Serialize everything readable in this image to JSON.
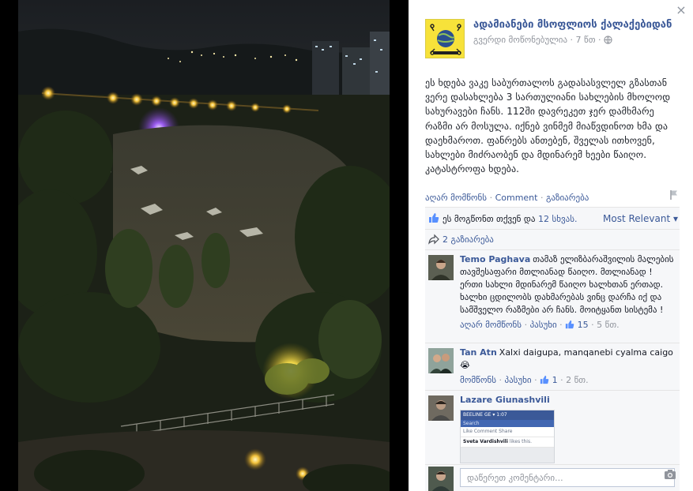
{
  "panel": {
    "close_label": "×",
    "page_name": "ადამიანები მსოფლიოს ქალაქებიდან",
    "page_meta": "გვერდი მოწონებულია · 7 წთ ·",
    "post_text": "ეს ხდება ვაკე საბურთალოს გადასასვლელ გზასთან ვერე დასახლება 3 სართულიანი სახლების მხოლოდ სახურავები ჩანს. 112ში დავრეკეთ ჯერ დამხმარე რაზმი არ მოსულა. იქნებ ვინმემ მიაწვდინოთ ხმა და დაეხმაროთ. ფანრებს ანთებენ, შველას ითხოვენ, სახლები მიძრაობენ და მდინარემ ხეები წაიღო. კატასტროფა ხდება.",
    "actions": {
      "unlike": "აღარ მომწონს",
      "comment": "Comment",
      "share": "გაზიარება",
      "sep": "·"
    },
    "likes": {
      "text_before": "ეს მოგწონთ თქვენ და ",
      "text_link": "12 სხვას.",
      "relevance": "Most Relevant ▾"
    },
    "shares": "2 გაზიარება",
    "comments": [
      {
        "author": "Temo Paghava",
        "text": "თამაზ ელიზბარაშვილის მალების თავშესაფარი მთლიანად წაიღო. მთლიანად ! ერთი სახლი მდინარემ წაიღო ხალხთან ერთად. ხალხი ცდილობს დახმარებას ვინც დარჩა იქ და სამშველო რაზმები არ ჩანს. მოიტყანთ სისტემა !",
        "action1": "აღარ მომწონს",
        "action2": "პასუხი",
        "likes": "15",
        "time": "5 წთ."
      },
      {
        "author": "Tan Atn",
        "text": "Xalxi daigupa, manqanebi cyalma caigo",
        "emoji": "😭",
        "action1": "მომწონს",
        "action2": "პასუხი",
        "likes": "1",
        "time": "2 წთ."
      },
      {
        "author": "Lazare Giunashvili",
        "shot": {
          "status": "BEELINE GE ▾ 1:07",
          "search": "Search",
          "row1": "Like   Comment   Share",
          "row2_name": "Sveta Vardishvili",
          "row2_rest": " likes this."
        }
      }
    ],
    "write_placeholder": "დაწერეთ კომენტარი...",
    "colors": {
      "link": "#3b5998",
      "meta": "#90949c",
      "panel_bg": "#f6f7f9"
    }
  }
}
